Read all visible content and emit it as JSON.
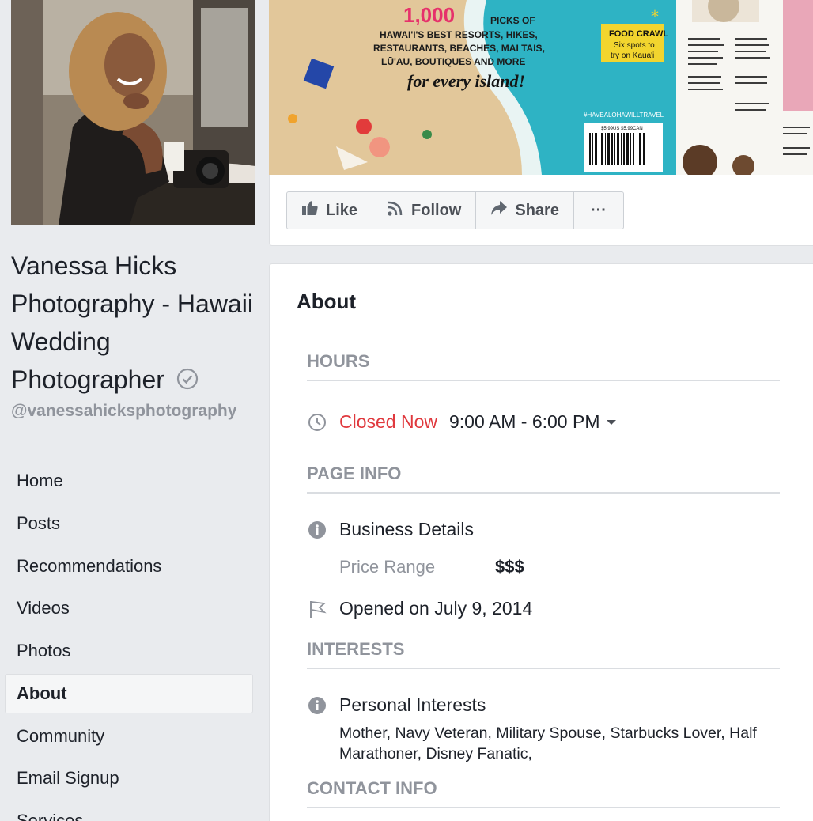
{
  "page": {
    "name": "Vanessa Hicks Photography - Hawaii Wedding Photographer",
    "handle": "@vanessahicksphotography",
    "verified_icon": "verified-check-icon"
  },
  "nav": {
    "items": [
      {
        "label": "Home"
      },
      {
        "label": "Posts"
      },
      {
        "label": "Recommendations"
      },
      {
        "label": "Videos"
      },
      {
        "label": "Photos"
      },
      {
        "label": "About",
        "active": true
      },
      {
        "label": "Community"
      },
      {
        "label": "Email Signup"
      },
      {
        "label": "Services"
      }
    ]
  },
  "cover": {
    "headline_number": "1,000",
    "headline_lines": [
      "PICKS OF",
      "HAWAI'I'S BEST RESORTS, HIKES,",
      "RESTAURANTS, BEACHES, MAI TAIS,",
      "LŪ'AU, BOUTIQUES AND MORE"
    ],
    "tagline": "for every island!",
    "food_crawl_title": "FOOD CRAWL",
    "food_crawl_sub": [
      "Six spots to",
      "try on Kaua'i"
    ],
    "hashtag": "#HAVEALOHAWILLTRAVEL",
    "price": "$5.99US $5.99CAN"
  },
  "actions": {
    "like": "Like",
    "follow": "Follow",
    "share": "Share",
    "more": "···"
  },
  "about": {
    "title": "About",
    "hours_header": "HOURS",
    "status": "Closed Now",
    "hours": "9:00 AM - 6:00 PM",
    "page_info_header": "PAGE INFO",
    "business_details": "Business Details",
    "price_range_label": "Price Range",
    "price_range_value": "$$$",
    "opened": "Opened on July 9, 2014",
    "interests_header": "INTERESTS",
    "personal_interests": "Personal Interests",
    "interests_text": "Mother, Navy Veteran, Military Spouse, Starbucks Lover, Half Marathoner, Disney Fanatic,",
    "contact_header": "CONTACT INFO"
  },
  "colors": {
    "closed_red": "#e0393e",
    "grey_text": "#90949c",
    "background": "#e9ebee"
  }
}
